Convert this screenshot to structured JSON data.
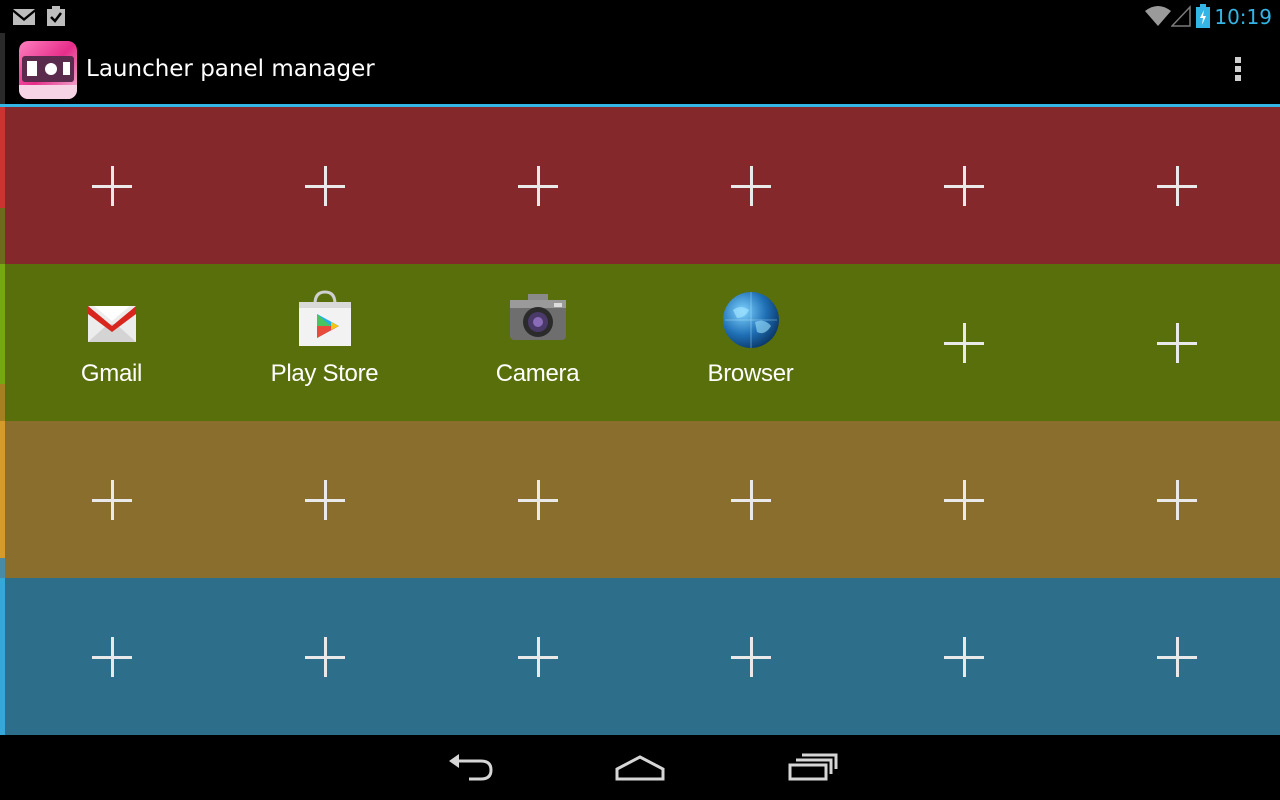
{
  "status_bar": {
    "time": "10:19",
    "icons": [
      "gmail-notification-icon",
      "task-notification-icon",
      "wifi-icon",
      "signal-icon",
      "battery-charging-icon"
    ]
  },
  "action_bar": {
    "title": "Launcher panel manager",
    "app_icon": "launcher-panel-manager-icon",
    "menu_icon": "overflow-menu-icon"
  },
  "colors": {
    "accent": "#33b5e5",
    "row_red": "#85282b",
    "row_green": "#586f0c",
    "row_gold": "#8a6e2d",
    "row_blue": "#2d6f8b"
  },
  "panels": {
    "row1": {
      "apps": []
    },
    "row2": {
      "apps": [
        {
          "label": "Gmail",
          "icon": "gmail-icon"
        },
        {
          "label": "Play Store",
          "icon": "play-store-icon"
        },
        {
          "label": "Camera",
          "icon": "camera-icon"
        },
        {
          "label": "Browser",
          "icon": "browser-globe-icon"
        }
      ]
    },
    "row3": {
      "apps": []
    },
    "row4": {
      "apps": []
    }
  },
  "nav_bar": {
    "buttons": [
      "back-icon",
      "home-icon",
      "recent-apps-icon"
    ]
  }
}
